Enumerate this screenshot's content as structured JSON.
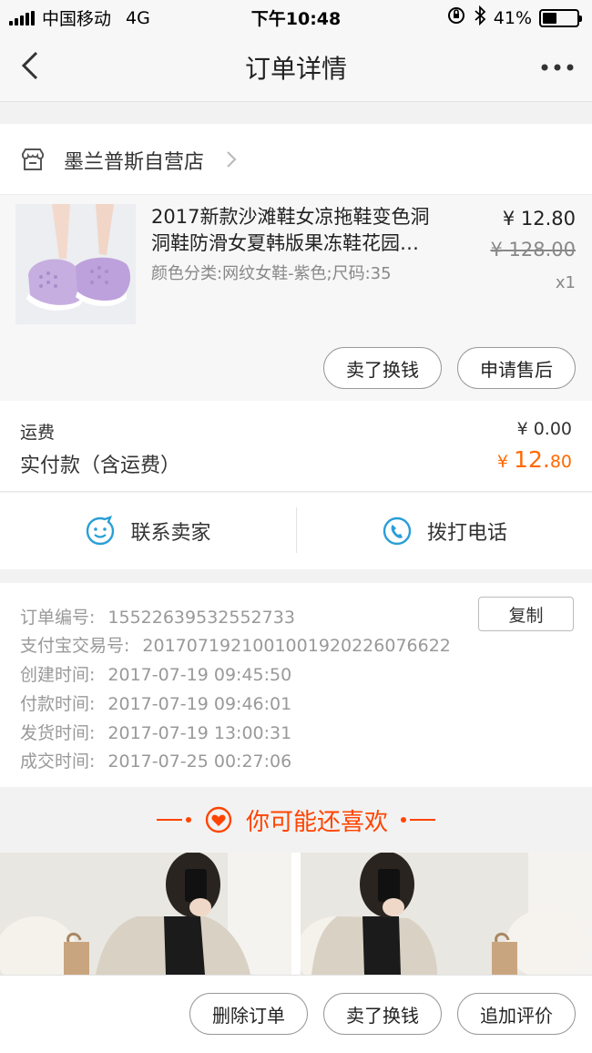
{
  "status_bar": {
    "carrier": "中国移动",
    "network": "4G",
    "time": "下午10:48",
    "battery_percent": "41%",
    "battery_level": 0.41
  },
  "nav": {
    "title": "订单详情",
    "back_icon": "chevron-left-icon",
    "more_icon": "more-dots-icon"
  },
  "store": {
    "name": "墨兰普斯自营店",
    "icon": "store-icon"
  },
  "product": {
    "title_line1": "2017新款沙滩鞋女凉拖鞋变色洞",
    "title_line2": "洞鞋防滑女夏韩版果冻鞋花园…",
    "spec": "颜色分类:网纹女鞋-紫色;尺码:35",
    "price": "¥ 12.80",
    "original_price": "¥ 128.00",
    "quantity": "x1",
    "actions": [
      "卖了换钱",
      "申请售后"
    ]
  },
  "fees": {
    "shipping_label": "运费",
    "shipping_value": "¥ 0.00",
    "paid_label": "实付款（含运费）",
    "paid_currency": "¥ ",
    "paid_integer": "12.",
    "paid_decimal": "80"
  },
  "contact": {
    "seller_label": "联系卖家",
    "phone_label": "拨打电话"
  },
  "order_info": {
    "copy_label": "复制",
    "rows": [
      {
        "label": "订单编号:",
        "value": "15522639532552733"
      },
      {
        "label": "支付宝交易号:",
        "value": "2017071921001001920226076622"
      },
      {
        "label": "创建时间:",
        "value": "2017-07-19 09:45:50"
      },
      {
        "label": "付款时间:",
        "value": "2017-07-19 09:46:01"
      },
      {
        "label": "发货时间:",
        "value": "2017-07-19 13:00:31"
      },
      {
        "label": "成交时间:",
        "value": "2017-07-25 00:27:06"
      }
    ]
  },
  "recommend": {
    "title": "你可能还喜欢",
    "accent_color": "#ff4400"
  },
  "bottom_bar": {
    "actions": [
      "删除订单",
      "卖了换钱",
      "追加评价"
    ]
  },
  "colors": {
    "price_orange": "#ff6a00",
    "accent": "#ff4400",
    "link_blue": "#2a9fd6"
  }
}
